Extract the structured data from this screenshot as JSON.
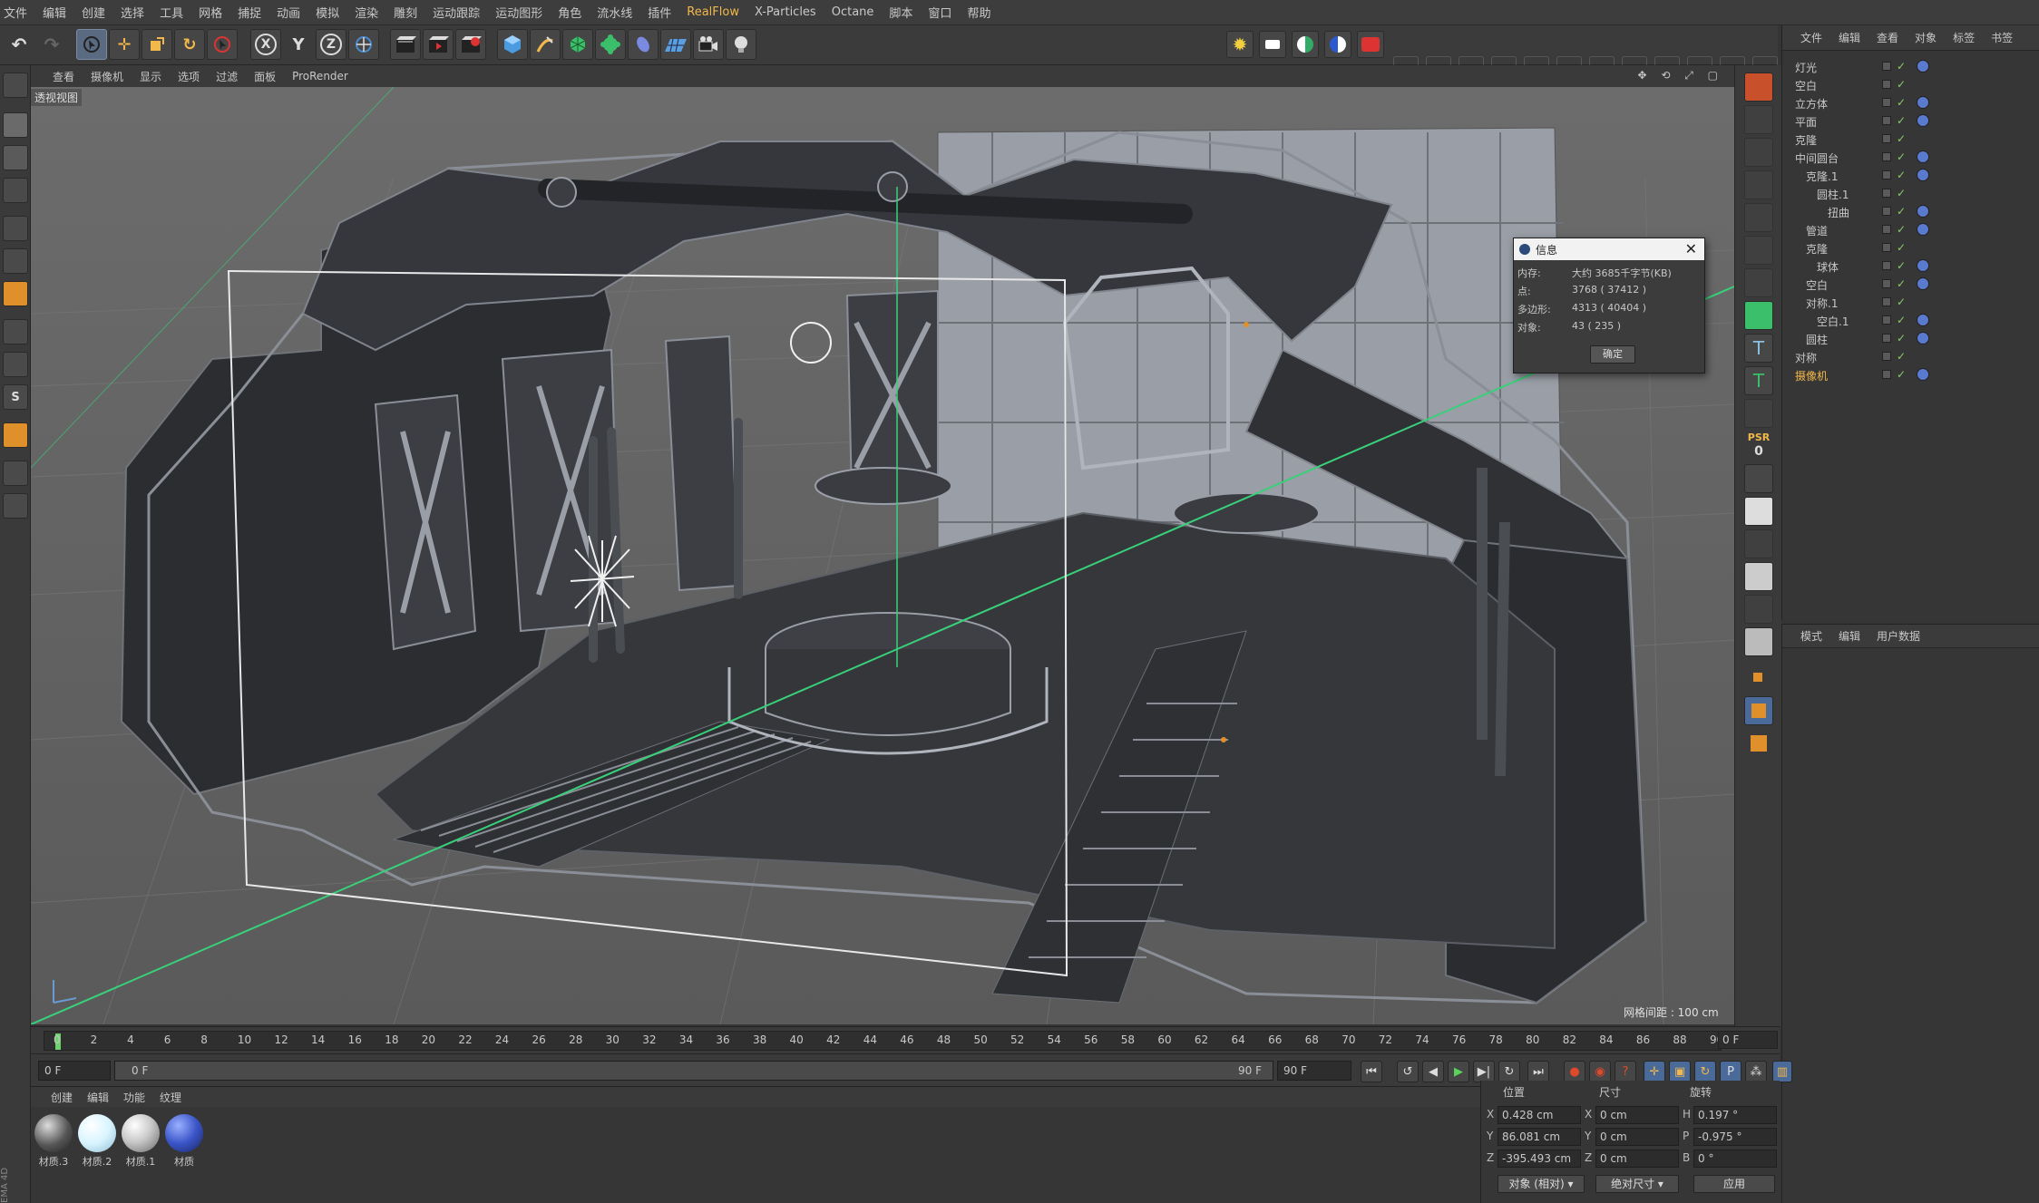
{
  "menubar": {
    "items": [
      "文件",
      "编辑",
      "创建",
      "选择",
      "工具",
      "网格",
      "捕捉",
      "动画",
      "模拟",
      "渲染",
      "雕刻",
      "运动跟踪",
      "运动图形",
      "角色",
      "流水线",
      "插件",
      "RealFlow",
      "X-Particles",
      "Octane",
      "脚本",
      "窗口",
      "帮助"
    ]
  },
  "toolbar": {
    "undo_icon": "undo-icon",
    "axis_x": "X",
    "axis_y": "Y",
    "axis_z": "Z"
  },
  "viewport": {
    "menu": [
      "查看",
      "摄像机",
      "显示",
      "选项",
      "过滤",
      "面板",
      "ProRender"
    ],
    "view_name": "透视视图",
    "grid_spacing": "网格间距 : 100 cm",
    "nav_icons": "✥ ⟲ ⤢ ▢"
  },
  "rightstrip": {
    "psr_label": "PSR",
    "psr_value": "0"
  },
  "object_manager": {
    "menu": [
      "文件",
      "编辑",
      "查看",
      "对象",
      "标签",
      "书签"
    ],
    "objects": [
      {
        "name": "灯光",
        "indent": 0
      },
      {
        "name": "空白",
        "indent": 0
      },
      {
        "name": "立方体",
        "indent": 0
      },
      {
        "name": "平面",
        "indent": 0
      },
      {
        "name": "克隆",
        "indent": 0
      },
      {
        "name": "中间圆台",
        "indent": 0
      },
      {
        "name": "克隆.1",
        "indent": 1
      },
      {
        "name": "圆柱.1",
        "indent": 2
      },
      {
        "name": "扭曲",
        "indent": 3
      },
      {
        "name": "管道",
        "indent": 1
      },
      {
        "name": "克隆",
        "indent": 1
      },
      {
        "name": "球体",
        "indent": 2
      },
      {
        "name": "空白",
        "indent": 1
      },
      {
        "name": "对称.1",
        "indent": 1
      },
      {
        "name": "空白.1",
        "indent": 2
      },
      {
        "name": "圆柱",
        "indent": 1
      },
      {
        "name": "对称",
        "indent": 0
      },
      {
        "name": "摄像机",
        "indent": 0,
        "highlight": true
      }
    ]
  },
  "attribute_manager": {
    "menu": [
      "模式",
      "编辑",
      "用户数据"
    ]
  },
  "timeline": {
    "ticks": [
      "0",
      "2",
      "4",
      "6",
      "8",
      "10",
      "12",
      "14",
      "16",
      "18",
      "20",
      "22",
      "24",
      "26",
      "28",
      "30",
      "32",
      "34",
      "36",
      "38",
      "40",
      "42",
      "44",
      "46",
      "48",
      "50",
      "52",
      "54",
      "56",
      "58",
      "60",
      "62",
      "64",
      "66",
      "68",
      "70",
      "72",
      "74",
      "76",
      "78",
      "80",
      "82",
      "84",
      "86",
      "88",
      "90"
    ],
    "current_frame": "0 F"
  },
  "transport": {
    "start_frame": "0 F",
    "slider_start": "0 F",
    "slider_end": "90 F",
    "end_frame": "90 F"
  },
  "materials": {
    "menu": [
      "创建",
      "编辑",
      "功能",
      "纹理"
    ],
    "items": [
      {
        "name": "材质.3",
        "color": "#6a6a6a"
      },
      {
        "name": "材质.2",
        "color": "#d8f4ff"
      },
      {
        "name": "材质.1",
        "color": "#c9c9c9"
      },
      {
        "name": "材质",
        "color": "#3b55c8"
      }
    ]
  },
  "coordinates": {
    "headers": [
      "位置",
      "尺寸",
      "旋转"
    ],
    "position": {
      "x": "0.428 cm",
      "y": "86.081 cm",
      "z": "-395.493 cm"
    },
    "size": {
      "x": "0 cm",
      "y": "0 cm",
      "z": "0 cm"
    },
    "rotation": {
      "h": "0.197 °",
      "p": "-0.975 °",
      "b": "0 °"
    },
    "axis_labels": {
      "x": "X",
      "y": "Y",
      "z": "Z",
      "h": "H",
      "p": "P",
      "b": "B"
    },
    "mode_object": "对象 (相对)",
    "mode_size": "绝对尺寸",
    "apply": "应用"
  },
  "info_dialog": {
    "title": "信息",
    "rows": [
      {
        "label": "内存:",
        "value": "大约 3685千字节(KB)"
      },
      {
        "label": "点:",
        "value": "3768 ( 37412 )"
      },
      {
        "label": "多边形:",
        "value": "4313 ( 40404 )"
      },
      {
        "label": "对象:",
        "value": "43 ( 235 )"
      }
    ],
    "ok": "确定"
  },
  "colors": {
    "accent": "#f2b84b",
    "green_axis": "#39d07a",
    "scene_dark": "#2b2d31"
  },
  "brand_vertical": "EMA 4D"
}
